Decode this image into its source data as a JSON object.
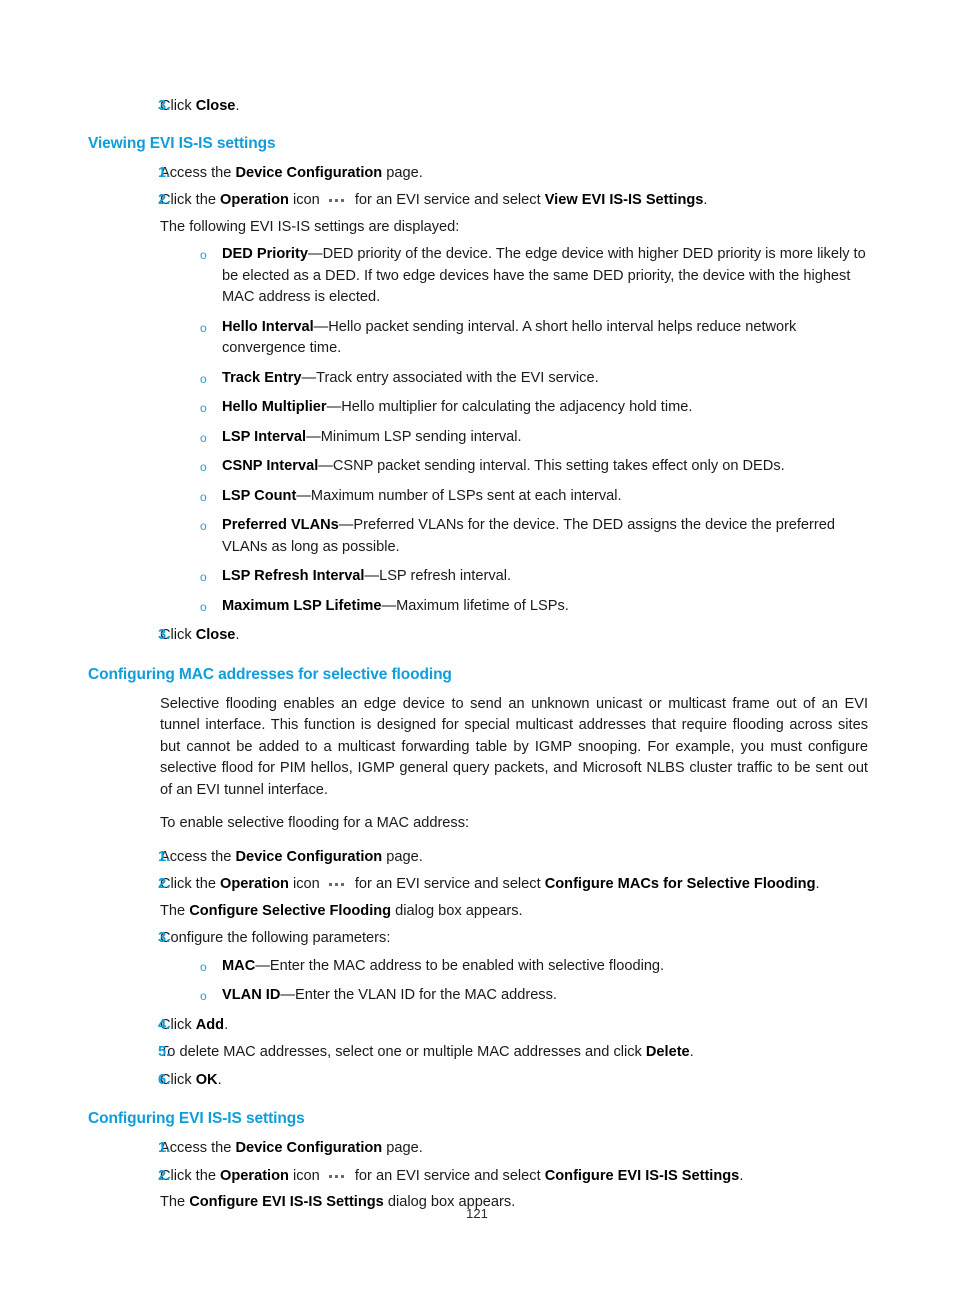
{
  "colors": {
    "heading_blue": "#0f9ddb",
    "marker_blue": "#0f9ddb",
    "bullet_blue": "#1b9fdc",
    "body_text": "#1a1a1a",
    "icon_gray": "#6b6b6b"
  },
  "icons": {
    "operation_icon": "ellipsis-icon"
  },
  "top_step": {
    "number": "3.",
    "text_before": "Click ",
    "bold": "Close",
    "text_after": "."
  },
  "sections": [
    {
      "id": "viewing-evi-isis-settings",
      "heading": "Viewing EVI IS-IS settings",
      "steps": [
        {
          "number": "1.",
          "parts": [
            {
              "t": "Access the ",
              "b": false
            },
            {
              "t": "Device Configuration",
              "b": true
            },
            {
              "t": " page.",
              "b": false
            }
          ]
        },
        {
          "number": "2.",
          "parts": [
            {
              "t": "Click the ",
              "b": false
            },
            {
              "t": "Operation",
              "b": true
            },
            {
              "t": " icon ",
              "b": false
            },
            {
              "t": "__ICON__",
              "b": false
            },
            {
              "t": " for an EVI service and select ",
              "b": false
            },
            {
              "t": "View EVI IS-IS Settings",
              "b": true
            },
            {
              "t": ".",
              "b": false
            }
          ],
          "note": "The following EVI IS-IS settings are displayed:"
        }
      ],
      "bullets": [
        {
          "term": "DED Priority",
          "dash": "—",
          "desc": "DED priority of the device. The edge device with higher DED priority is more likely to be elected as a DED. If two edge devices have the same DED priority, the device with the highest MAC address is elected."
        },
        {
          "term": "Hello Interval",
          "dash": "—",
          "desc": "Hello packet sending interval. A short hello interval helps reduce network convergence time."
        },
        {
          "term": "Track Entry",
          "dash": "—",
          "desc": "Track entry associated with the EVI service."
        },
        {
          "term": "Hello Multiplier",
          "dash": "—",
          "desc": "Hello multiplier for calculating the adjacency hold time."
        },
        {
          "term": "LSP Interval",
          "dash": "—",
          "desc": "Minimum LSP sending interval."
        },
        {
          "term": "CSNP Interval",
          "dash": "—",
          "desc": "CSNP packet sending interval. This setting takes effect only on DEDs."
        },
        {
          "term": "LSP Count",
          "dash": "—",
          "desc": "Maximum number of LSPs sent at each interval."
        },
        {
          "term": "Preferred VLANs",
          "dash": "—",
          "desc": "Preferred VLANs for the device. The DED assigns the device the preferred VLANs as long as possible."
        },
        {
          "term": "LSP Refresh Interval",
          "dash": "—",
          "desc": "LSP refresh interval."
        },
        {
          "term": "Maximum LSP Lifetime",
          "dash": "—",
          "desc": "Maximum lifetime of LSPs."
        }
      ],
      "final_step": {
        "number": "3.",
        "text_before": "Click ",
        "bold": "Close",
        "text_after": "."
      }
    },
    {
      "id": "configuring-mac-addresses-for-selective-flooding",
      "heading": "Configuring MAC addresses for selective flooding",
      "intro_paragraph": "Selective flooding enables an edge device to send an unknown unicast or multicast frame out of an EVI tunnel interface. This function is designed for special multicast addresses that require flooding across sites but cannot be added to a multicast forwarding table by IGMP snooping. For example, you must configure selective flood for PIM hellos, IGMP general query packets, and Microsoft NLBS cluster traffic to be sent out of an EVI tunnel interface.",
      "lead_in": "To enable selective flooding for a MAC address:",
      "steps": [
        {
          "number": "1.",
          "parts": [
            {
              "t": "Access the ",
              "b": false
            },
            {
              "t": "Device Configuration",
              "b": true
            },
            {
              "t": " page.",
              "b": false
            }
          ]
        },
        {
          "number": "2.",
          "parts": [
            {
              "t": "Click the ",
              "b": false
            },
            {
              "t": "Operation",
              "b": true
            },
            {
              "t": " icon ",
              "b": false
            },
            {
              "t": "__ICON__",
              "b": false
            },
            {
              "t": " for an EVI service and select ",
              "b": false
            },
            {
              "t": "Configure MACs for Selective Flooding",
              "b": true
            },
            {
              "t": ".",
              "b": false
            }
          ],
          "note_parts": [
            {
              "t": "The ",
              "b": false
            },
            {
              "t": "Configure Selective Flooding",
              "b": true
            },
            {
              "t": " dialog box appears.",
              "b": false
            }
          ]
        },
        {
          "number": "3.",
          "parts": [
            {
              "t": "Configure the following parameters:",
              "b": false
            }
          ],
          "bullets": [
            {
              "term": "MAC",
              "dash": "—",
              "desc": "Enter the MAC address to be enabled with selective flooding."
            },
            {
              "term": "VLAN ID",
              "dash": "—",
              "desc": "Enter the VLAN ID for the MAC address."
            }
          ]
        },
        {
          "number": "4.",
          "parts": [
            {
              "t": "Click ",
              "b": false
            },
            {
              "t": "Add",
              "b": true
            },
            {
              "t": ".",
              "b": false
            }
          ]
        },
        {
          "number": "5.",
          "parts": [
            {
              "t": "To delete MAC addresses, select one or multiple MAC addresses and click ",
              "b": false
            },
            {
              "t": "Delete",
              "b": true
            },
            {
              "t": ".",
              "b": false
            }
          ]
        },
        {
          "number": "6.",
          "parts": [
            {
              "t": "Click ",
              "b": false
            },
            {
              "t": "OK",
              "b": true
            },
            {
              "t": ".",
              "b": false
            }
          ]
        }
      ]
    },
    {
      "id": "configuring-evi-isis-settings",
      "heading": "Configuring EVI IS-IS settings",
      "steps": [
        {
          "number": "1.",
          "parts": [
            {
              "t": "Access the ",
              "b": false
            },
            {
              "t": "Device Configuration",
              "b": true
            },
            {
              "t": " page.",
              "b": false
            }
          ]
        },
        {
          "number": "2.",
          "parts": [
            {
              "t": "Click the ",
              "b": false
            },
            {
              "t": "Operation",
              "b": true
            },
            {
              "t": " icon ",
              "b": false
            },
            {
              "t": "__ICON__",
              "b": false
            },
            {
              "t": " for an EVI service and select ",
              "b": false
            },
            {
              "t": "Configure EVI IS-IS Settings",
              "b": true
            },
            {
              "t": ".",
              "b": false
            }
          ],
          "note_parts": [
            {
              "t": "The ",
              "b": false
            },
            {
              "t": "Configure EVI IS-IS Settings",
              "b": true
            },
            {
              "t": " dialog box appears.",
              "b": false
            }
          ]
        }
      ]
    }
  ],
  "footer": {
    "page_number": "121"
  }
}
